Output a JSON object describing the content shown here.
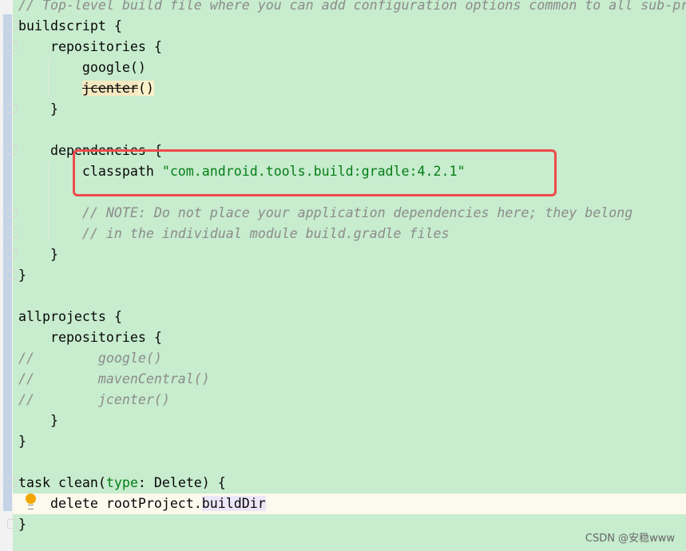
{
  "editor": {
    "lines": {
      "l0": "// Top-level build file where you can add configuration options common to all sub-pr",
      "l1": "buildscript {",
      "l2": "    repositories {",
      "l3": "        google()",
      "l4a": "        ",
      "l4b": "jcenter",
      "l4c": "()",
      "l5": "    }",
      "l7": "    dependencies {",
      "l8a": "        classpath ",
      "l8b": "\"com.android.tools.build:gradle:4.2.1\"",
      "l10": "        // NOTE: Do not place your application dependencies here; they belong",
      "l11": "        // in the individual module build.gradle files",
      "l12": "    }",
      "l13": "}",
      "l15": "allprojects {",
      "l16": "    repositories {",
      "l17": "//        google()",
      "l18": "//        mavenCentral()",
      "l19": "//        jcenter()",
      "l20": "    }",
      "l21": "}",
      "l23a": "task clean(",
      "l23b": "type",
      "l23c": ": Delete) {",
      "l24a": "    delete rootProject.",
      "l24b": "buildDir",
      "l25": "}"
    },
    "colors": {
      "background": "#c7ecce",
      "highlight_box": "#ef4b4b",
      "string": "#067d17",
      "comment": "#8c8c8c"
    }
  },
  "watermark": "CSDN @安稳www"
}
